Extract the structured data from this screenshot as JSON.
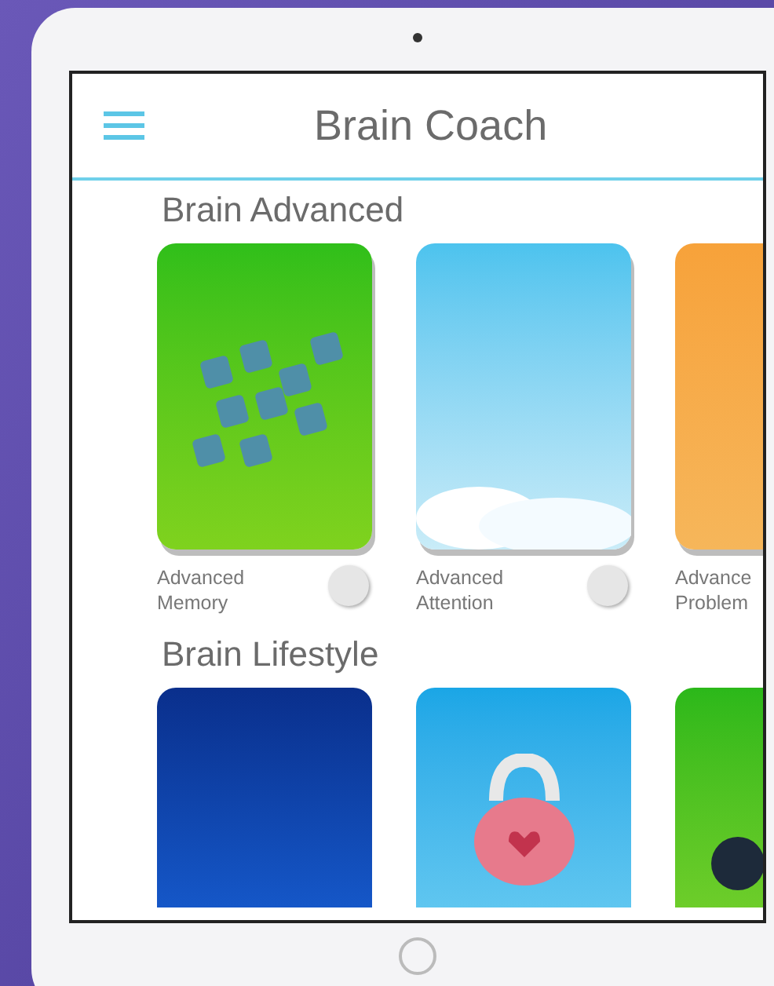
{
  "app_bar": {
    "title": "Brain Coach"
  },
  "sections": [
    {
      "title": "Brain Advanced",
      "cards": [
        {
          "kind": "memory",
          "label": "Advanced Memory",
          "checked": false
        },
        {
          "kind": "sky",
          "label": "Advanced Attention",
          "checked": false
        },
        {
          "kind": "orange",
          "label": "Advance Problem"
        }
      ]
    },
    {
      "title": "Brain Lifestyle",
      "cards": [
        {
          "kind": "night"
        },
        {
          "kind": "kettlebell"
        },
        {
          "kind": "bomb"
        }
      ]
    }
  ]
}
